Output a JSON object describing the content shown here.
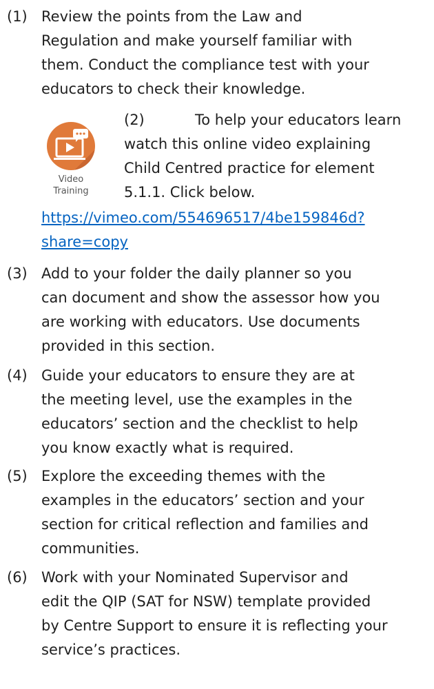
{
  "items": [
    {
      "number": "(1)",
      "lines": [
        "Review the points from the Law and",
        "Regulation and make yourself familiar with",
        "them. Conduct the compliance test with your",
        "educators to check their knowledge."
      ]
    },
    {
      "number": "(2)",
      "lines": [
        "To help your educators learn",
        "watch this online video explaining",
        "Child Centred practice for element",
        "5.1.1. Click below."
      ],
      "link_lines": [
        "https://vimeo.com/554696517/4be159846d?",
        "share=copy"
      ]
    },
    {
      "number": "(3)",
      "lines": [
        "Add to your folder the daily planner so you",
        "can document and show the assessor how you",
        "are working with educators. Use documents",
        "provided in this section."
      ]
    },
    {
      "number": "(4)",
      "lines": [
        "Guide your educators to ensure they are at",
        "the meeting level, use the examples in the",
        "educators’ section and the checklist to help",
        "you know exactly what is required."
      ]
    },
    {
      "number": "(5)",
      "lines": [
        "Explore the exceeding themes with the",
        "examples in the educators’ section and your",
        "section for critical reflection and families and",
        "communities."
      ]
    },
    {
      "number": "(6)",
      "lines": [
        "Work with your Nominated Supervisor and",
        "edit the QIP (SAT for NSW) template provided",
        "by Centre Support to ensure it is reflecting your",
        "service’s practices."
      ]
    }
  ],
  "video_icon": {
    "caption_line1": "Video",
    "caption_line2": "Training",
    "icon_name": "video-training-icon",
    "circle_color": "#e07a3a"
  },
  "colors": {
    "text": "#1f1f1f",
    "link": "#0563c1"
  }
}
